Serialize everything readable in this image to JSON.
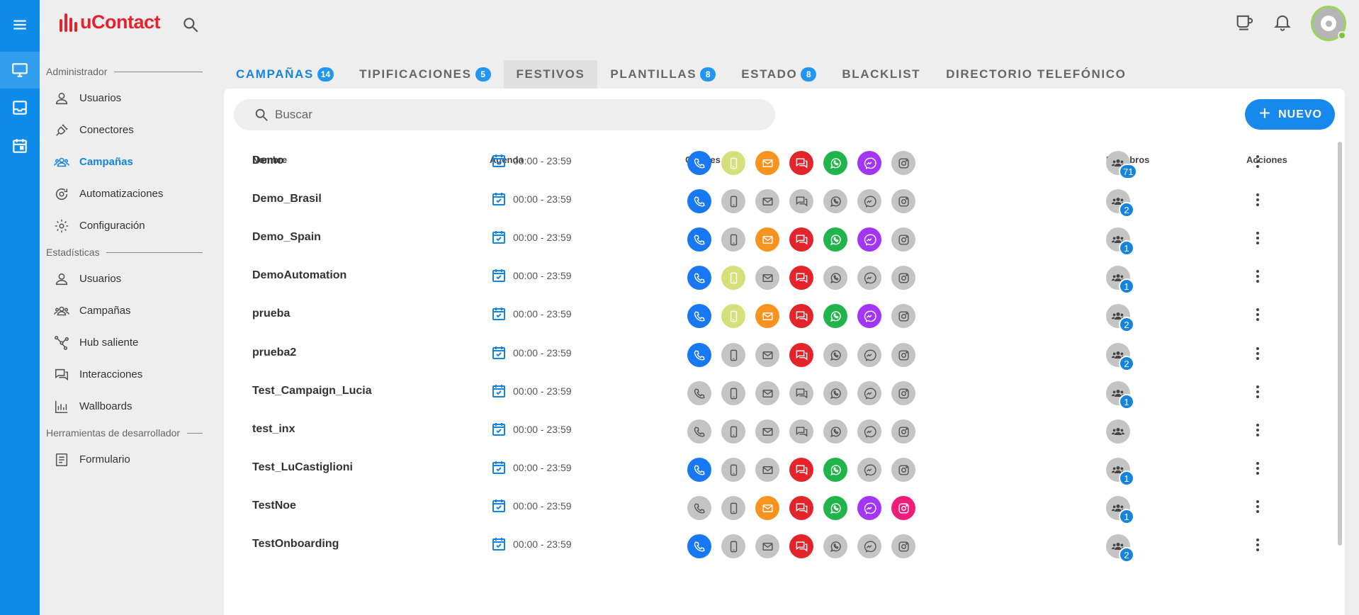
{
  "app": {
    "title": "uContact"
  },
  "sidebar": {
    "sections": [
      {
        "label": "Administrador",
        "items": [
          {
            "label": "Usuarios",
            "icon": "person-icon",
            "active": false
          },
          {
            "label": "Conectores",
            "icon": "plug-icon",
            "active": false
          },
          {
            "label": "Campañas",
            "icon": "group-icon",
            "active": true
          },
          {
            "label": "Automatizaciones",
            "icon": "automation-icon",
            "active": false
          },
          {
            "label": "Configuración",
            "icon": "gear-icon",
            "active": false
          }
        ]
      },
      {
        "label": "Estadísticas",
        "items": [
          {
            "label": "Usuarios",
            "icon": "person-icon",
            "active": false
          },
          {
            "label": "Campañas",
            "icon": "group-icon",
            "active": false
          },
          {
            "label": "Hub saliente",
            "icon": "hub-icon",
            "active": false
          },
          {
            "label": "Interacciones",
            "icon": "chat-icon",
            "active": false
          },
          {
            "label": "Wallboards",
            "icon": "bar-chart-icon",
            "active": false
          }
        ]
      },
      {
        "label": "Herramientas de desarrollador",
        "items": [
          {
            "label": "Formulario",
            "icon": "form-icon",
            "active": false
          }
        ]
      }
    ]
  },
  "tabs": [
    {
      "label": "CAMPAÑAS",
      "badge": "14",
      "active": true
    },
    {
      "label": "TIPIFICACIONES",
      "badge": "5",
      "active": false
    },
    {
      "label": "FESTIVOS",
      "badge": "",
      "active": false,
      "hover": true
    },
    {
      "label": "PLANTILLAS",
      "badge": "8",
      "active": false
    },
    {
      "label": "ESTADO",
      "badge": "8",
      "active": false
    },
    {
      "label": "BLACKLIST",
      "badge": "",
      "active": false
    },
    {
      "label": "DIRECTORIO TELEFÓNICO",
      "badge": "",
      "active": false
    }
  ],
  "search": {
    "placeholder": "Buscar"
  },
  "new_button": {
    "label": "NUEVO"
  },
  "table": {
    "headers": {
      "name": "Nombre",
      "agenda": "Agenda",
      "channels": "Canales",
      "members": "Miembros",
      "actions": "Acciones"
    },
    "channel_order": [
      "phone",
      "mobile",
      "email",
      "chat",
      "whatsapp",
      "messenger",
      "instagram"
    ],
    "rows": [
      {
        "name": "Demo",
        "schedule": "00:00 - 23:59",
        "channels": [
          1,
          1,
          1,
          1,
          1,
          1,
          0
        ],
        "members": "71"
      },
      {
        "name": "Demo_Brasil",
        "schedule": "00:00 - 23:59",
        "channels": [
          1,
          0,
          0,
          0,
          0,
          0,
          0
        ],
        "members": "2"
      },
      {
        "name": "Demo_Spain",
        "schedule": "00:00 - 23:59",
        "channels": [
          1,
          0,
          1,
          1,
          1,
          1,
          0
        ],
        "members": "1"
      },
      {
        "name": "DemoAutomation",
        "schedule": "00:00 - 23:59",
        "channels": [
          1,
          1,
          0,
          1,
          0,
          0,
          0
        ],
        "members": "1"
      },
      {
        "name": "prueba",
        "schedule": "00:00 - 23:59",
        "channels": [
          1,
          1,
          1,
          1,
          1,
          1,
          0
        ],
        "members": "2"
      },
      {
        "name": "prueba2",
        "schedule": "00:00 - 23:59",
        "channels": [
          1,
          0,
          0,
          1,
          0,
          0,
          0
        ],
        "members": "2"
      },
      {
        "name": "Test_Campaign_Lucia",
        "schedule": "00:00 - 23:59",
        "channels": [
          0,
          0,
          0,
          0,
          0,
          0,
          0
        ],
        "members": "1"
      },
      {
        "name": "test_inx",
        "schedule": "00:00 - 23:59",
        "channels": [
          0,
          0,
          0,
          0,
          0,
          0,
          0
        ],
        "members": ""
      },
      {
        "name": "Test_LuCastiglioni",
        "schedule": "00:00 - 23:59",
        "channels": [
          1,
          0,
          0,
          1,
          1,
          0,
          0
        ],
        "members": "1"
      },
      {
        "name": "TestNoe",
        "schedule": "00:00 - 23:59",
        "channels": [
          0,
          0,
          1,
          1,
          1,
          1,
          1
        ],
        "members": "1"
      },
      {
        "name": "TestOnboarding",
        "schedule": "00:00 - 23:59",
        "channels": [
          1,
          0,
          0,
          1,
          0,
          0,
          0
        ],
        "members": "2"
      }
    ]
  }
}
